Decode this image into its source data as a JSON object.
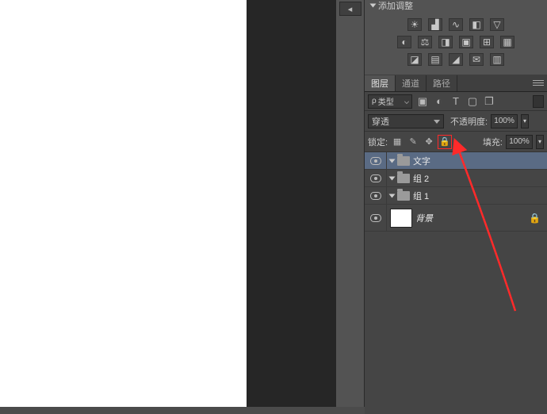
{
  "adjustments": {
    "title": "添加调整"
  },
  "tabs": {
    "layers": "图层",
    "channels": "通道",
    "paths": "路径"
  },
  "filter": {
    "kind_prefix": "ρ",
    "kind_label": "类型"
  },
  "blend": {
    "mode": "穿透",
    "opacity_label": "不透明度:",
    "opacity_value": "100%"
  },
  "lock": {
    "label": "锁定:",
    "fill_label": "填充:",
    "fill_value": "100%"
  },
  "layers": [
    {
      "name": "文字",
      "type": "group",
      "selected": true
    },
    {
      "name": "组 2",
      "type": "group",
      "selected": false
    },
    {
      "name": "组 1",
      "type": "group",
      "selected": false
    },
    {
      "name": "背景",
      "type": "background",
      "locked": true
    }
  ],
  "annotation": {
    "color": "#ff2a2a"
  }
}
